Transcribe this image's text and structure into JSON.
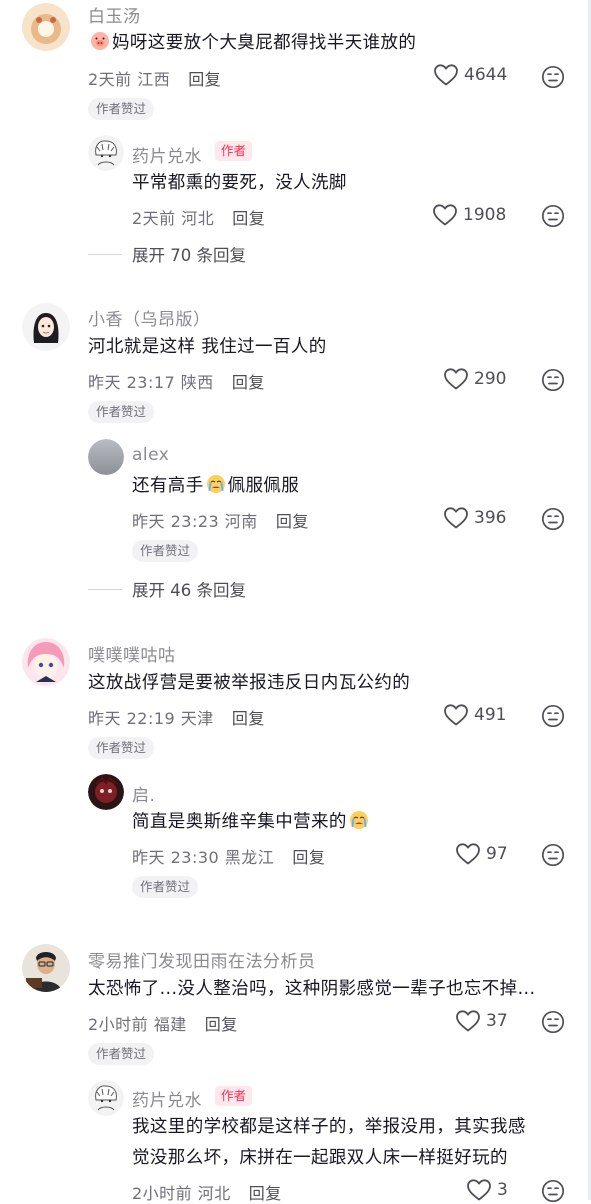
{
  "badges": {
    "author_liked": "作者赞过",
    "author": "作者"
  },
  "comments": [
    {
      "user": "白玉汤",
      "text": "妈呀这要放个大臭屁都得找半天谁放的",
      "time": "2天前",
      "location": "江西",
      "reply": "回复",
      "likes": "4644",
      "reply_item": {
        "user": "药片兑水",
        "text": "平常都熏的要死，没人洗脚",
        "time": "2天前",
        "location": "河北",
        "reply": "回复",
        "likes": "1908"
      },
      "expand": "展开 70 条回复"
    },
    {
      "user": "小香（乌昂版）",
      "text": "河北就是这样 我住过一百人的",
      "time": "昨天 23:17",
      "location": "陕西",
      "reply": "回复",
      "likes": "290",
      "reply_item": {
        "user": "alex",
        "text_before": "还有高手",
        "text_after": "佩服佩服",
        "time": "昨天 23:23",
        "location": "河南",
        "reply": "回复",
        "likes": "396"
      },
      "expand": "展开 46 条回复"
    },
    {
      "user": "噗噗噗咕咕",
      "text": "这放战俘营是要被举报违反日内瓦公约的",
      "time": "昨天 22:19",
      "location": "天津",
      "reply": "回复",
      "likes": "491",
      "reply_item": {
        "user": "启.",
        "text": "简直是奥斯维辛集中营来的",
        "time": "昨天 23:30",
        "location": "黑龙江",
        "reply": "回复",
        "likes": "97"
      }
    },
    {
      "user": "零易推门发现田雨在法分析员",
      "text": "太恐怖了...没人整治吗，这种阴影感觉一辈子也忘不掉...",
      "time": "2小时前",
      "location": "福建",
      "reply": "回复",
      "likes": "37",
      "reply_item": {
        "user": "药片兑水",
        "text_line1": "我这里的学校都是这样子的，举报没用，其实我感",
        "text_line2": "觉没那么坏，床拼在一起跟双人床一样挺好玩的",
        "time": "2小时前",
        "location": "河北",
        "reply": "回复",
        "likes": "3"
      }
    }
  ],
  "icons": {
    "like": "heart-outline-icon",
    "dislike": "unhappy-face-icon",
    "emoji_pig": "pig-face-emoji",
    "emoji_crying": "crying-face-emoji"
  },
  "colors": {
    "author_tag": "#fe2c55",
    "text": "#161823",
    "meta": "#6f7079"
  }
}
